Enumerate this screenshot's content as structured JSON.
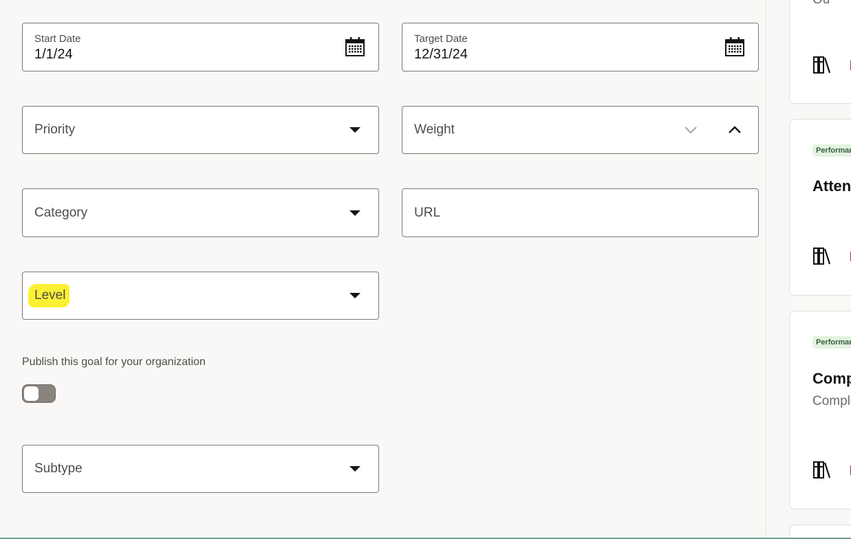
{
  "form": {
    "start_date": {
      "label": "Start Date",
      "value": "1/1/24"
    },
    "target_date": {
      "label": "Target Date",
      "value": "12/31/24"
    },
    "priority": {
      "placeholder": "Priority"
    },
    "weight": {
      "placeholder": "Weight"
    },
    "category": {
      "placeholder": "Category"
    },
    "url": {
      "placeholder": "URL"
    },
    "level": {
      "placeholder": "Level"
    },
    "publish": {
      "label": "Publish this goal for your organization",
      "enabled": false
    },
    "subtype": {
      "placeholder": "Subtype"
    }
  },
  "side_cards": [
    {
      "badge": "",
      "title": "",
      "desc": "Ou",
      "icon": "library-icon"
    },
    {
      "badge": "Performan",
      "title": "Atten",
      "desc": "",
      "icon": "library-icon"
    },
    {
      "badge": "Performan",
      "title": "Comp",
      "desc": "Comple",
      "icon": "library-icon"
    }
  ],
  "icons": {
    "date_picker": "calendar-icon",
    "dropdown": "caret-down-icon",
    "weight_decrease": "chevron-down-icon",
    "weight_increase": "chevron-up-icon"
  },
  "colors": {
    "background": "#f9f8f6",
    "field_border": "#7d7874",
    "highlight": "#fcf033",
    "badge_bg": "#e3f3df",
    "badge_text": "#34603d",
    "toggle_off": "#8a847e"
  }
}
